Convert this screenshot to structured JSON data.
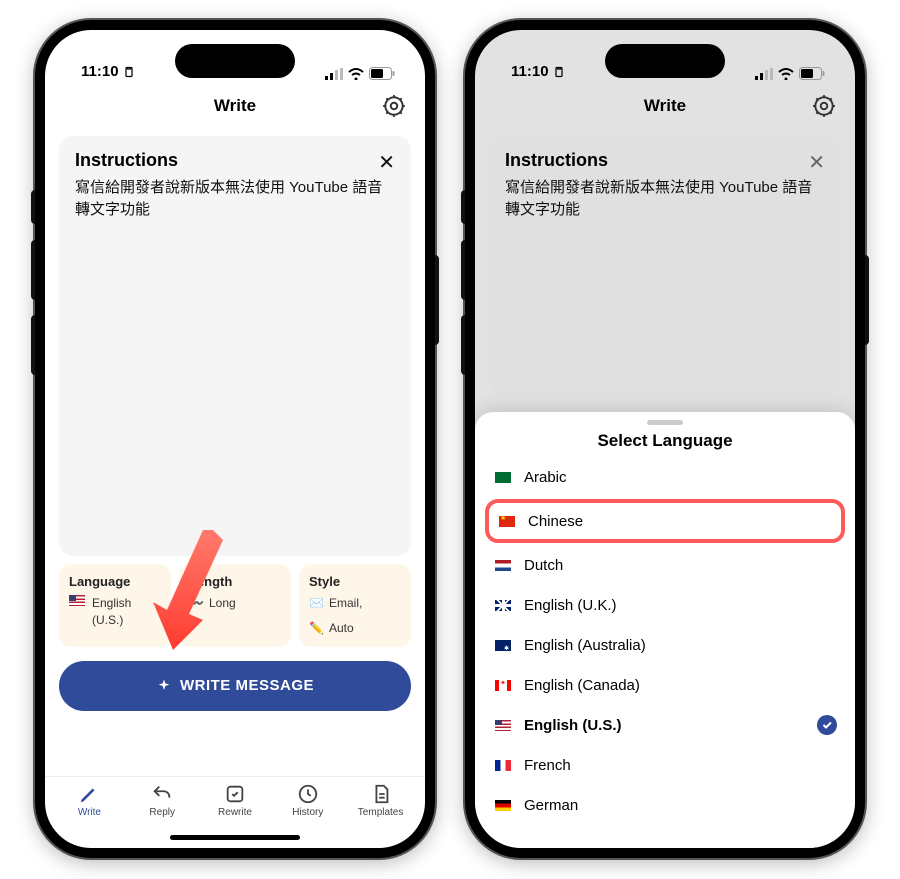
{
  "status": {
    "time": "11:10"
  },
  "nav": {
    "title": "Write"
  },
  "instructions": {
    "heading": "Instructions",
    "body": "寫信給開發者說新版本無法使用 YouTube 語音轉文字功能"
  },
  "options": {
    "language": {
      "label": "Language",
      "value": "English (U.S.)",
      "flag": "flag-us"
    },
    "length": {
      "label": "Length",
      "value": "Long",
      "icon": "〰️"
    },
    "style": {
      "label": "Style",
      "value1": "Email,",
      "value2": "Auto",
      "icon1": "✉️",
      "icon2": "✏️"
    }
  },
  "cta": "WRITE MESSAGE",
  "tabs": [
    {
      "label": "Write",
      "icon": "pencil"
    },
    {
      "label": "Reply",
      "icon": "reply"
    },
    {
      "label": "Rewrite",
      "icon": "rewrite"
    },
    {
      "label": "History",
      "icon": "clock"
    },
    {
      "label": "Templates",
      "icon": "doc"
    }
  ],
  "sheet": {
    "title": "Select Language",
    "items": [
      {
        "label": "Arabic",
        "flag": "flag-sa"
      },
      {
        "label": "Chinese",
        "flag": "flag-cn",
        "highlight": true
      },
      {
        "label": "Dutch",
        "flag": "flag-nl"
      },
      {
        "label": "English (U.K.)",
        "flag": "flag-gb"
      },
      {
        "label": "English (Australia)",
        "flag": "flag-au"
      },
      {
        "label": "English (Canada)",
        "flag": "flag-ca"
      },
      {
        "label": "English (U.S.)",
        "flag": "flag-us",
        "selected": true
      },
      {
        "label": "French",
        "flag": "flag-fr"
      },
      {
        "label": "German",
        "flag": "flag-de"
      }
    ]
  }
}
